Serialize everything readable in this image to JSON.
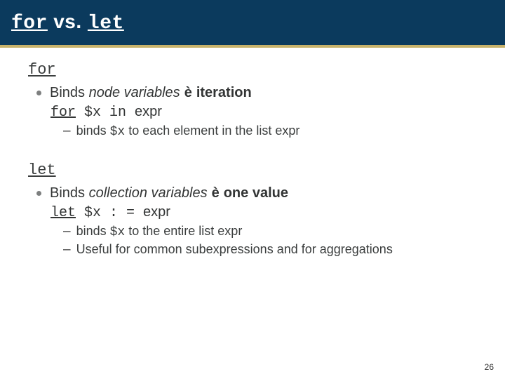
{
  "title": {
    "kw1": "for",
    "mid": " vs. ",
    "kw2": "let"
  },
  "sections": [
    {
      "head": "for",
      "bullet": {
        "prefix": "Binds ",
        "italic": "node variables",
        "arrow": "è",
        "bold": "iteration"
      },
      "code": {
        "kw": "for",
        "rest_mono": " $x in ",
        "rest_plain": "expr"
      },
      "subs": [
        {
          "pre": "binds ",
          "mono": "$x",
          "post": " to each element in the list expr"
        }
      ]
    },
    {
      "head": "let",
      "bullet": {
        "prefix": "Binds ",
        "italic": "collection variables",
        "arrow": "è",
        "bold": "one value"
      },
      "code": {
        "kw": "let",
        "rest_mono": " $x : = ",
        "rest_plain": "expr"
      },
      "subs": [
        {
          "pre": "binds ",
          "mono": "$x",
          "post": " to the entire list expr"
        },
        {
          "pre": "Useful for common subexpressions and for aggregations",
          "mono": "",
          "post": ""
        }
      ]
    }
  ],
  "page_number": "26"
}
